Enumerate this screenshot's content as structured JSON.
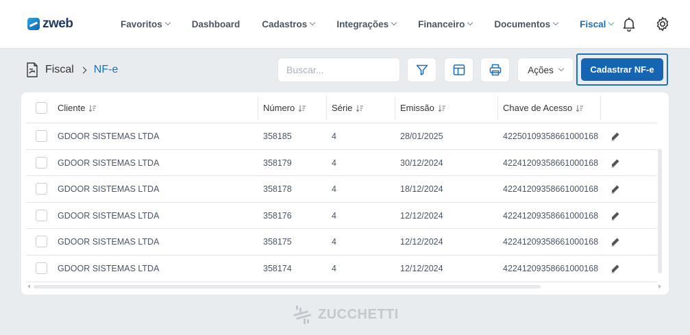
{
  "app": {
    "logo_text": "zweb",
    "brand_color": "#1565b3"
  },
  "nav": {
    "items": [
      {
        "label": "Favoritos",
        "has_dropdown": true
      },
      {
        "label": "Dashboard",
        "has_dropdown": false
      },
      {
        "label": "Cadastros",
        "has_dropdown": true
      },
      {
        "label": "Integrações",
        "has_dropdown": true
      },
      {
        "label": "Financeiro",
        "has_dropdown": true
      },
      {
        "label": "Documentos",
        "has_dropdown": true
      },
      {
        "label": "Fiscal",
        "has_dropdown": true,
        "active": true
      }
    ],
    "icons": [
      "bell-icon",
      "gear-icon"
    ]
  },
  "breadcrumb": {
    "icon": "document-invoice-icon",
    "root": "Fiscal",
    "current": "NF-e"
  },
  "toolbar": {
    "search_placeholder": "Buscar...",
    "filter_icon": "filter-icon",
    "columns_icon": "columns-layout-icon",
    "print_icon": "printer-icon",
    "actions_label": "Ações",
    "primary_label": "Cadastrar NF-e"
  },
  "table": {
    "columns": [
      "Cliente",
      "Número",
      "Série",
      "Emissão",
      "Chave de Acesso"
    ],
    "rows": [
      {
        "cliente": "GDOOR SISTEMAS LTDA",
        "numero": "358185",
        "serie": "4",
        "emissao": "28/01/2025",
        "chave": "42250109358661000168"
      },
      {
        "cliente": "GDOOR SISTEMAS LTDA",
        "numero": "358179",
        "serie": "4",
        "emissao": "30/12/2024",
        "chave": "42241209358661000168"
      },
      {
        "cliente": "GDOOR SISTEMAS LTDA",
        "numero": "358178",
        "serie": "4",
        "emissao": "18/12/2024",
        "chave": "42241209358661000168"
      },
      {
        "cliente": "GDOOR SISTEMAS LTDA",
        "numero": "358176",
        "serie": "4",
        "emissao": "12/12/2024",
        "chave": "42241209358661000168"
      },
      {
        "cliente": "GDOOR SISTEMAS LTDA",
        "numero": "358175",
        "serie": "4",
        "emissao": "12/12/2024",
        "chave": "42241209358661000168"
      },
      {
        "cliente": "GDOOR SISTEMAS LTDA",
        "numero": "358174",
        "serie": "4",
        "emissao": "12/12/2024",
        "chave": "42241209358661000168"
      }
    ],
    "row_action_icon": "pencil-edit-icon"
  },
  "footer": {
    "logo_text": "ZUCCHETTI"
  }
}
